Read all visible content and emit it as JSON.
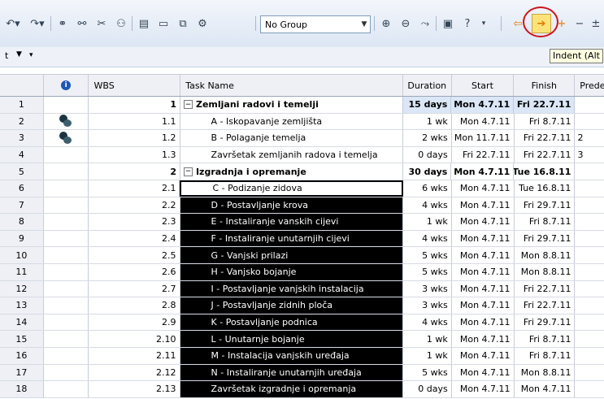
{
  "toolbar": {
    "group_select": {
      "value": "No Group"
    },
    "indent_tooltip": "Indent (Alt"
  },
  "row2": {
    "left_text": "t"
  },
  "table": {
    "columns": {
      "id": "",
      "indicators": "i",
      "wbs": "WBS",
      "name": "Task Name",
      "duration": "Duration",
      "start": "Start",
      "finish": "Finish",
      "pred": "Predec"
    },
    "rows": [
      {
        "id": "1",
        "wbs": "1",
        "name": "Zemljani radovi i temelji",
        "duration": "15 days",
        "start": "Mon 4.7.11",
        "finish": "Fri 22.7.11",
        "pred": ""
      },
      {
        "id": "2",
        "wbs": "1.1",
        "name": "A - Iskopavanje zemljišta",
        "duration": "1 wk",
        "start": "Mon 4.7.11",
        "finish": "Fri 8.7.11",
        "pred": ""
      },
      {
        "id": "3",
        "wbs": "1.2",
        "name": "B - Polaganje temelja",
        "duration": "2 wks",
        "start": "Mon 11.7.11",
        "finish": "Fri 22.7.11",
        "pred": "2"
      },
      {
        "id": "4",
        "wbs": "1.3",
        "name": "Završetak zemljanih radova i temelja",
        "duration": "0 days",
        "start": "Fri 22.7.11",
        "finish": "Fri 22.7.11",
        "pred": "3"
      },
      {
        "id": "5",
        "wbs": "2",
        "name": "Izgradnja i opremanje",
        "duration": "30 days",
        "start": "Mon 4.7.11",
        "finish": "Tue 16.8.11",
        "pred": ""
      },
      {
        "id": "6",
        "wbs": "2.1",
        "name": "C - Podizanje zidova",
        "duration": "6 wks",
        "start": "Mon 4.7.11",
        "finish": "Tue 16.8.11",
        "pred": ""
      },
      {
        "id": "7",
        "wbs": "2.2",
        "name": "D - Postavljanje krova",
        "duration": "4 wks",
        "start": "Mon 4.7.11",
        "finish": "Fri 29.7.11",
        "pred": ""
      },
      {
        "id": "8",
        "wbs": "2.3",
        "name": "E - Instaliranje vanskih cijevi",
        "duration": "1 wk",
        "start": "Mon 4.7.11",
        "finish": "Fri 8.7.11",
        "pred": ""
      },
      {
        "id": "9",
        "wbs": "2.4",
        "name": "F - Instaliranje unutarnjih cijevi",
        "duration": "4 wks",
        "start": "Mon 4.7.11",
        "finish": "Fri 29.7.11",
        "pred": ""
      },
      {
        "id": "10",
        "wbs": "2.5",
        "name": "G - Vanjski prilazi",
        "duration": "5 wks",
        "start": "Mon 4.7.11",
        "finish": "Mon 8.8.11",
        "pred": ""
      },
      {
        "id": "11",
        "wbs": "2.6",
        "name": "H - Vanjsko bojanje",
        "duration": "5 wks",
        "start": "Mon 4.7.11",
        "finish": "Mon 8.8.11",
        "pred": ""
      },
      {
        "id": "12",
        "wbs": "2.7",
        "name": "I - Postavljanje vanjskih instalacija",
        "duration": "3 wks",
        "start": "Mon 4.7.11",
        "finish": "Fri 22.7.11",
        "pred": ""
      },
      {
        "id": "13",
        "wbs": "2.8",
        "name": "J - Postavljanje zidnih ploča",
        "duration": "3 wks",
        "start": "Mon 4.7.11",
        "finish": "Fri 22.7.11",
        "pred": ""
      },
      {
        "id": "14",
        "wbs": "2.9",
        "name": "K - Postavljanje podnica",
        "duration": "4 wks",
        "start": "Mon 4.7.11",
        "finish": "Fri 29.7.11",
        "pred": ""
      },
      {
        "id": "15",
        "wbs": "2.10",
        "name": "L - Unutarnje bojanje",
        "duration": "1 wk",
        "start": "Mon 4.7.11",
        "finish": "Fri 8.7.11",
        "pred": ""
      },
      {
        "id": "16",
        "wbs": "2.11",
        "name": "M - Instalacija vanjskih uređaja",
        "duration": "1 wk",
        "start": "Mon 4.7.11",
        "finish": "Fri 8.7.11",
        "pred": ""
      },
      {
        "id": "17",
        "wbs": "2.12",
        "name": "N - Instaliranje unutarnjih uređaja",
        "duration": "5 wks",
        "start": "Mon 4.7.11",
        "finish": "Mon 8.8.11",
        "pred": ""
      },
      {
        "id": "18",
        "wbs": "2.13",
        "name": "Završetak izgradnje i opremanja",
        "duration": "0 days",
        "start": "Mon 4.7.11",
        "finish": "Mon 4.7.11",
        "pred": ""
      }
    ]
  }
}
